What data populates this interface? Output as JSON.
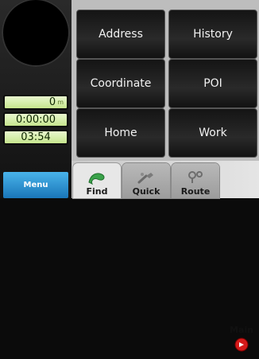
{
  "left_panel": {
    "distance_value": "0",
    "distance_unit": "m",
    "elapsed_time": "0:00:00",
    "clock": "03:54",
    "menu_label": "Menu"
  },
  "grid": {
    "buttons": [
      "Address",
      "History",
      "Coordinate",
      "POI",
      "Home",
      "Work"
    ]
  },
  "tabs": [
    {
      "label": "Find",
      "icon": "find-icon",
      "active": true
    },
    {
      "label": "Quick",
      "icon": "quick-icon",
      "active": false
    },
    {
      "label": "Route",
      "icon": "route-icon",
      "active": false
    }
  ],
  "main": {
    "label": "Main",
    "icon": "main-red-icon",
    "color": "#d41a1a"
  },
  "colors": {
    "menu_button": "#2a8fd0",
    "readout_bg": "#d6efa8",
    "grid_button": "#1a1a1a"
  }
}
